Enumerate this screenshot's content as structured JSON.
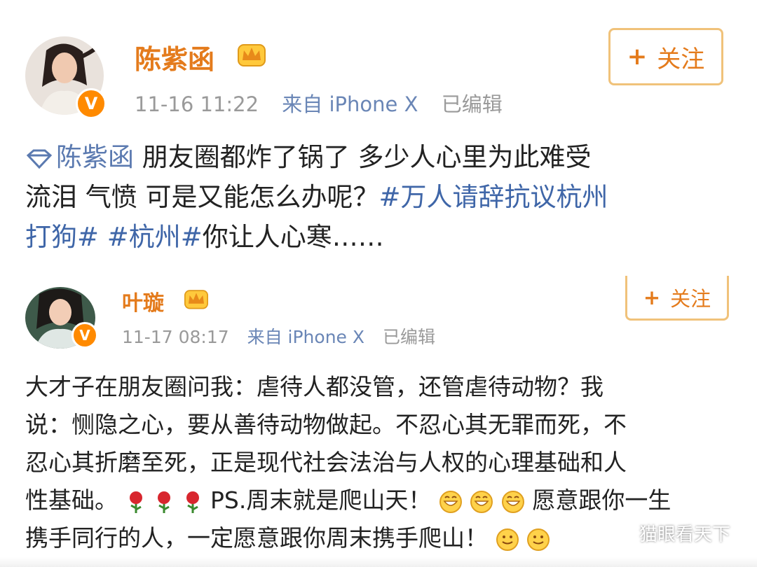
{
  "posts": [
    {
      "name": "陈紫函",
      "time": "11-16 11:22",
      "source": "来自 iPhone X",
      "edited": "已编辑",
      "follow": {
        "plus": "+",
        "label": "关注"
      },
      "mention": "陈紫函",
      "line1_rest": " 朋友圈都炸了锅了 多少人心里为此难受",
      "line2_a": "流泪 气愤 可是又能怎么办呢？",
      "line2_tag": "#万人请辞抗议杭州",
      "line3_tag_end": "打狗#",
      "line3_tag2": " #杭州#",
      "line3_rest": "你让人心寒……"
    },
    {
      "name": "叶璇",
      "time": "11-17 08:17",
      "source": "来自 iPhone X",
      "edited": "已编辑",
      "follow": {
        "plus": "+",
        "label": "关注"
      },
      "lines": [
        "大才子在朋友圈问我：虐待人都没管，还管虐待动物？我",
        "说：恻隐之心，要从善待动物做起。不忍心其无罪而死，不",
        "忍心其折磨至死，正是现代社会法治与人权的心理基础和人"
      ],
      "line4_a": "性基础。",
      "line4_b": "PS.周末就是爬山天！",
      "line4_c": "愿意跟你一生",
      "line5": "携手同行的人，一定愿意跟你周末携手爬山！"
    }
  ],
  "watermark": "猫眼看天下",
  "colors": {
    "name": "#e47b1c",
    "meta": "#9a9a9a",
    "source": "#6a86b6",
    "tag": "#3f66a8",
    "follow_border": "#f0c27a",
    "verified": "#ff8a00"
  },
  "icons": [
    "avatar",
    "verified-badge-icon",
    "vip-crown-icon",
    "diamond-mention-icon",
    "rose-emoji-icon",
    "grin-emoji-icon",
    "wechat-icon"
  ]
}
